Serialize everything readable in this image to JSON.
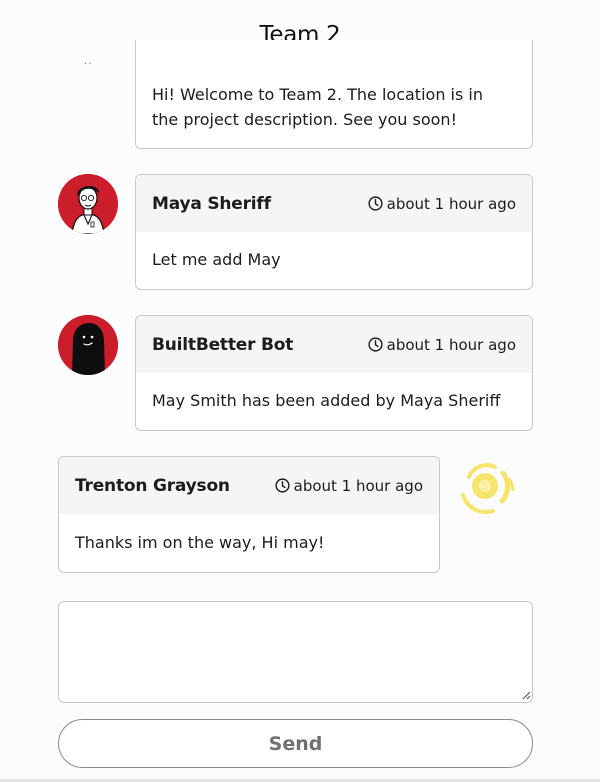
{
  "header": {
    "title": "Team 2"
  },
  "messages": [
    {
      "sender": "",
      "time": "",
      "body": "Hi! Welcome to Team 2. The location is in the project description. See you soon!"
    },
    {
      "sender": "Maya Sheriff",
      "time": "about 1 hour ago",
      "body": "Let me add May",
      "avatar": "maya-sheriff-avatar"
    },
    {
      "sender": "BuiltBetter Bot",
      "time": "about 1 hour ago",
      "body": "May Smith has been added by Maya Sheriff",
      "avatar": "bot-avatar"
    },
    {
      "sender": "Trenton Grayson",
      "time": "about 1 hour ago",
      "body": "Thanks im on the way, Hi may!",
      "avatar": "trenton-grayson-avatar"
    }
  ],
  "composer": {
    "placeholder": "",
    "send_label": "Send"
  },
  "colors": {
    "avatar_red": "#cc1d2a",
    "avatar_yellow": "#f7e46a",
    "card_header": "#f5f5f6"
  },
  "icons": {
    "time": "clock-icon"
  }
}
